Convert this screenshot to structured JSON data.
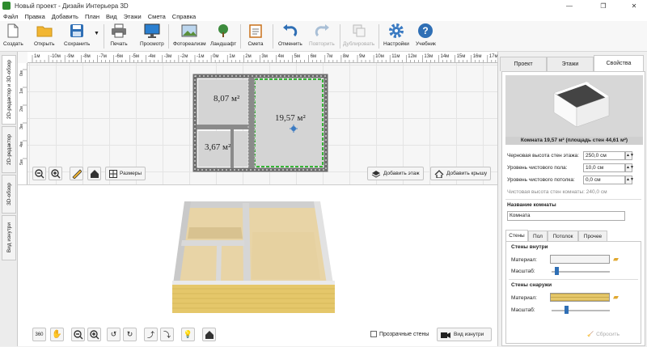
{
  "window": {
    "title": "Новый проект - Дизайн Интерьера 3D",
    "min": "—",
    "max": "❐",
    "close": "✕"
  },
  "menu": [
    "Файл",
    "Правка",
    "Добавить",
    "План",
    "Вид",
    "Этажи",
    "Смета",
    "Справка"
  ],
  "toolbar": {
    "create": "Создать",
    "open": "Открыть",
    "save": "Сохранить",
    "print": "Печать",
    "preview": "Просмотр",
    "photo": "Фотореализм",
    "landscape": "Ландшафт",
    "estimate": "Смета",
    "undo": "Отменить",
    "redo": "Повторить",
    "duplicate": "Дублировать",
    "settings": "Настройки",
    "tutorial": "Учебник"
  },
  "left_tabs": [
    "2D-редактор и 3D-обзор",
    "2D-редактор",
    "3D-обзор",
    "Вид изнутри"
  ],
  "ruler": {
    "h_labels": [
      "1м",
      "-10м",
      "-9м",
      "-8м",
      "-7м",
      "-6м",
      "-5м",
      "-4м",
      "-3м",
      "-2м",
      "-1м",
      "0м",
      "1м",
      "2м",
      "3м",
      "4м",
      "5м",
      "6м",
      "7м",
      "8м",
      "9м",
      "10м",
      "11м",
      "12м",
      "13м",
      "14м",
      "15м",
      "16м",
      "17м"
    ],
    "v_labels": [
      "0м",
      "1м",
      "2м",
      "3м",
      "4м",
      "5м"
    ]
  },
  "plan": {
    "room1": "8,07 м²",
    "room2": "19,57 м²",
    "room3": "3,67 м²",
    "sizes_btn": "Размеры",
    "add_floor_btn": "Добавить этаж",
    "add_roof_btn": "Добавить крышу"
  },
  "view3d": {
    "transparent_walls": "Прозрачные стены",
    "inside_view_btn": "Вид изнутри"
  },
  "right": {
    "tabs": [
      "Проект",
      "Этажи",
      "Свойства"
    ],
    "caption": "Комната 19,57 м²  (площадь стен 44,61 м²)",
    "fields": [
      {
        "label": "Черновая высота стен этажа:",
        "value": "250,0 см"
      },
      {
        "label": "Уровень чистового пола:",
        "value": "10,0 см"
      },
      {
        "label": "Уровень чистового потолка:",
        "value": "0,0 см"
      }
    ],
    "net_height": "Чистовая высота стен комнаты: 240,0 см",
    "room_name_label": "Название комнаты",
    "room_name_value": "Комната",
    "subtabs": [
      "Стены",
      "Пол",
      "Потолок",
      "Прочее"
    ],
    "walls_inside": "Стены внутри",
    "walls_outside": "Стены снаружи",
    "material": "Материал:",
    "scale": "Масштаб:",
    "reset": "Сбросить"
  },
  "colors": {
    "accent": "#2e8b2e",
    "brick": "#e5c76a",
    "floor": "#e9d3a4",
    "wall": "#dcdcdc"
  }
}
